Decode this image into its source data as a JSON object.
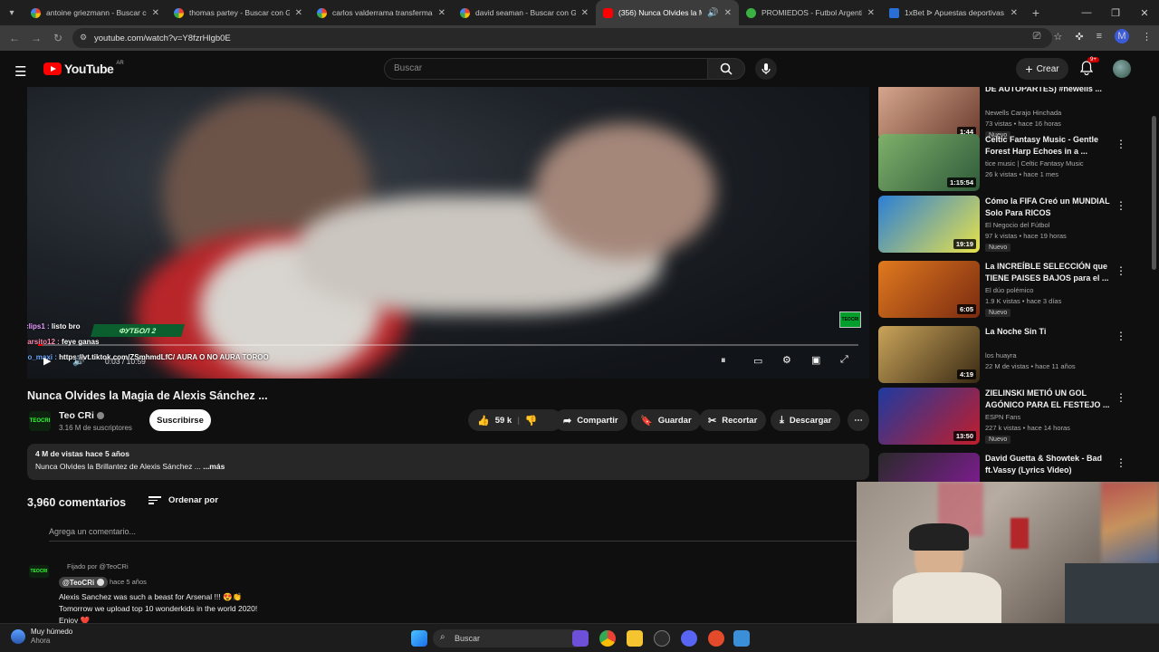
{
  "browser": {
    "tabs": [
      {
        "label": "antoine griezmann - Buscar con Google",
        "icon": "google-icon",
        "active": false
      },
      {
        "label": "thomas partey - Buscar con Google",
        "icon": "google-icon",
        "active": false
      },
      {
        "label": "carlos valderrama transfermarkt",
        "icon": "google-icon",
        "active": false
      },
      {
        "label": "david seaman - Buscar con Google",
        "icon": "google-icon",
        "active": false
      },
      {
        "label": "(356) Nunca Olvides la Magia",
        "icon": "youtube-icon",
        "active": true
      },
      {
        "label": "PROMIEDOS - Futbol Argentino",
        "icon": "promiedos-icon",
        "active": false
      },
      {
        "label": "1xBet ᐉ Apuestas deportivas en",
        "icon": "1xbet-icon",
        "active": false
      }
    ],
    "url": "youtube.com/watch?v=Y8fzrHlgb0E",
    "profile_initial": "M"
  },
  "youtube": {
    "logo_text": "YouTube",
    "country": "AR",
    "search_placeholder": "Buscar",
    "create_label": "Crear",
    "notifications_badge": "9+"
  },
  "player": {
    "chat": [
      {
        "user": "Myclips1 :",
        "text": "listo bro"
      },
      {
        "user": "edgarsito12 :",
        "text": "feye ganas"
      },
      {
        "user": "diego_maxi :",
        "text": "https://vt.tiktok.com/ZSmhmdLfC/ AURA O NO AURA TOROO"
      }
    ],
    "lower_third": "ФУТБОЛ 2",
    "time": "0:03 / 10:59",
    "progress": 0.005
  },
  "video": {
    "title": "Nunca Olvides la Magia de Alexis Sánchez ...",
    "channel": "Teo CRi",
    "channel_avatar": "TEOCRI",
    "subscribers": "3.16 M de suscriptores",
    "subscribe_label": "Suscribirse",
    "likes": "59 k",
    "share_label": "Compartir",
    "save_label": "Guardar",
    "clip_label": "Recortar",
    "download_label": "Descargar",
    "views_age": "4 M de vistas  hace 5 años",
    "description": "Nunca Olvides la Brillantez de Alexis Sánchez ...",
    "more_label": "...más"
  },
  "comments": {
    "count": "3,960 comentarios",
    "sort_label": "Ordenar por",
    "add_placeholder": "Agrega un comentario...",
    "pinned": {
      "pinned_by": "Fijado por @TeoCRi",
      "author": "@TeoCRi",
      "age": "hace 5 años",
      "lines": [
        "Alexis Sanchez was such a beast for Arsenal !!! 😍👏",
        "Tomorrow we upload top 10 wonderkids in the world 2020!",
        "Enjoy ❤️"
      ]
    }
  },
  "recommendations": [
    {
      "title": "DE AUTOPARTES) #newells ...",
      "channel": "Newells Carajo Hinchada",
      "stats": "73 vistas • hace 16 horas",
      "badge": "Nuevo",
      "duration": "1:44",
      "colors": [
        "#d8a98f",
        "#6b3c2e"
      ]
    },
    {
      "title": "Celtic Fantasy Music - Gentle Forest Harp Echoes in a ...",
      "channel": "tice music | Celtic Fantasy Music",
      "stats": "26 k vistas • hace 1 mes",
      "badge": "",
      "duration": "1:15:54",
      "colors": [
        "#7fb06a",
        "#2f5a3a"
      ]
    },
    {
      "title": "Cómo la FIFA Creó un MUNDIAL Solo Para RICOS",
      "channel": "El Negocio del Fútbol",
      "stats": "97 k vistas • hace 19 horas",
      "badge": "Nuevo",
      "duration": "19:19",
      "colors": [
        "#2b7fd6",
        "#e8e24a"
      ]
    },
    {
      "title": "La INCREÍBLE SELECCIÓN que TIENE PAISES BAJOS para el ...",
      "channel": "El dúo polémico",
      "stats": "1.9 K vistas • hace 3 días",
      "badge": "Nuevo",
      "duration": "6:05",
      "colors": [
        "#e07a1f",
        "#7a2a10"
      ]
    },
    {
      "title": "La Noche Sin Ti",
      "channel": "los huayra",
      "stats": "22 M de vistas • hace 11 años",
      "badge": "",
      "duration": "4:19",
      "colors": [
        "#c9a45a",
        "#3a2a14"
      ]
    },
    {
      "title": "ZIELINSKI METIÓ UN GOL AGÓNICO PARA EL FESTEJO ...",
      "channel": "ESPN Fans",
      "stats": "227 k vistas • hace 14 horas",
      "badge": "Nuevo",
      "duration": "13:50",
      "colors": [
        "#1e3aa0",
        "#c21d2b"
      ]
    },
    {
      "title": "David Guetta & Showtek - Bad ft.Vassy (Lyrics Video)",
      "channel": "",
      "stats": "",
      "badge": "",
      "duration": "",
      "colors": [
        "#2a2a2a",
        "#8a1aa0"
      ]
    }
  ],
  "taskbar": {
    "weather_title": "Muy húmedo",
    "weather_sub": "Ahora",
    "search_label": "Buscar"
  }
}
